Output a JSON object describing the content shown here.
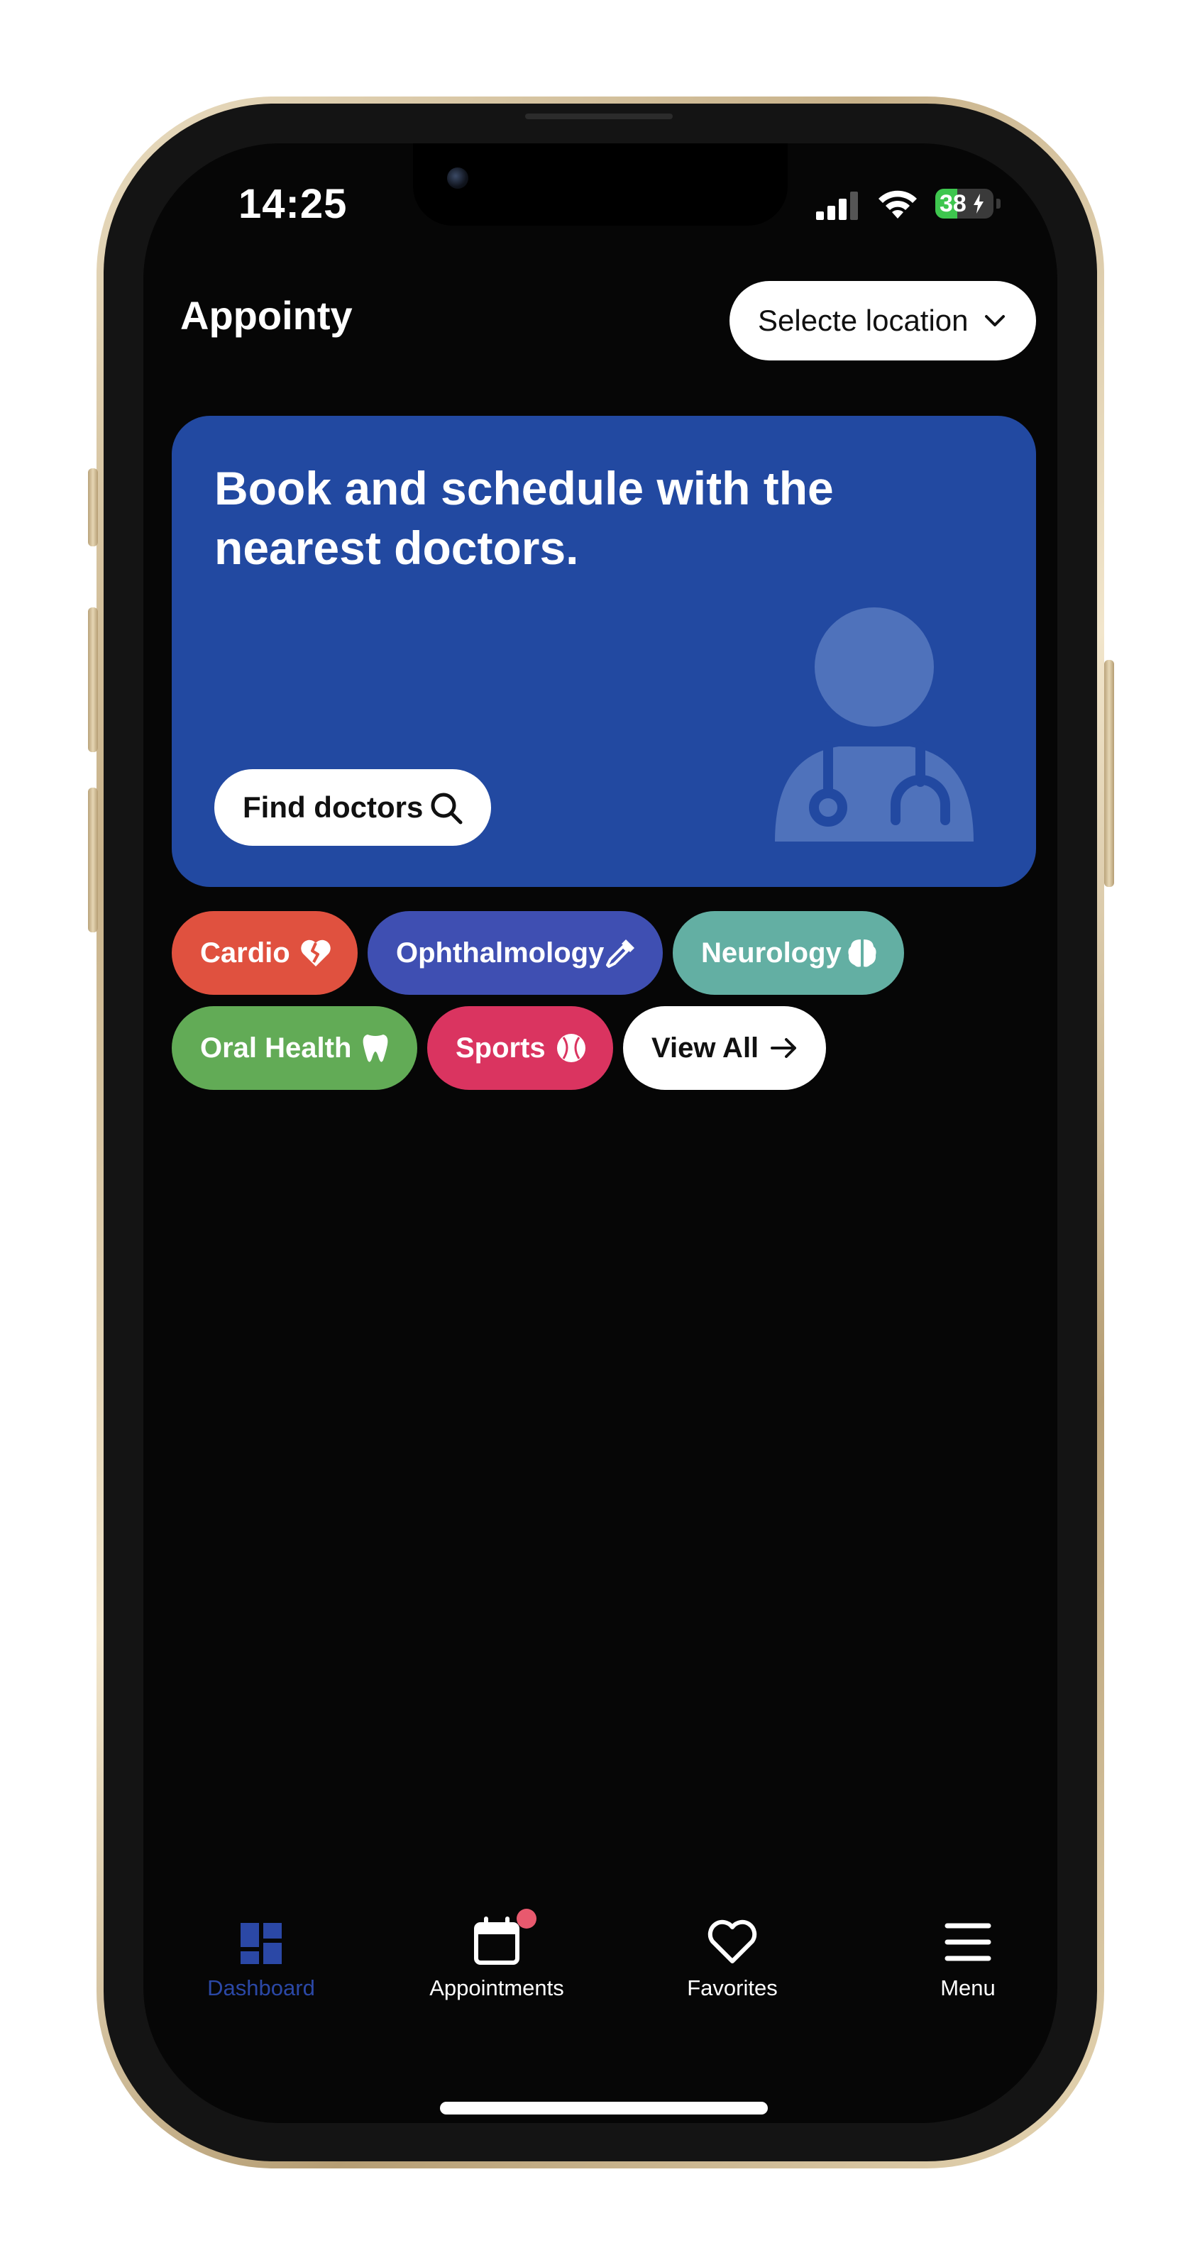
{
  "status_bar": {
    "time": "14:25",
    "battery_percent": "38",
    "battery_level": 0.38,
    "signal_bars": 3
  },
  "header": {
    "app_title": "Appointy",
    "location_label": "Selecte location",
    "location_icon": "chevron-down-icon"
  },
  "hero": {
    "title": "Book and schedule with the nearest doctors.",
    "cta_label": "Find doctors",
    "cta_icon": "search-icon",
    "illustration": "doctor-icon",
    "background": "#2249a1"
  },
  "categories": [
    {
      "label": "Cardio",
      "icon": "broken-heart-icon",
      "color": "#e0513f"
    },
    {
      "label": "Ophthalmology",
      "icon": "eyedropper-icon",
      "color": "#3f4fb2"
    },
    {
      "label": "Neurology",
      "icon": "brain-icon",
      "color": "#63afa3"
    },
    {
      "label": "Oral Health",
      "icon": "tooth-icon",
      "color": "#62ab56"
    },
    {
      "label": "Sports",
      "icon": "baseball-icon",
      "color": "#da3460"
    },
    {
      "label": "View All",
      "icon": "arrow-right-icon",
      "color": "#ffffff"
    }
  ],
  "bottom_nav": {
    "items": [
      {
        "label": "Dashboard",
        "icon": "dashboard-icon",
        "active": true
      },
      {
        "label": "Appointments",
        "icon": "calendar-icon",
        "active": false,
        "has_notification": true
      },
      {
        "label": "Favorites",
        "icon": "heart-icon",
        "active": false
      },
      {
        "label": "Menu",
        "icon": "menu-icon",
        "active": false
      }
    ],
    "active_color": "#2b48a6"
  }
}
